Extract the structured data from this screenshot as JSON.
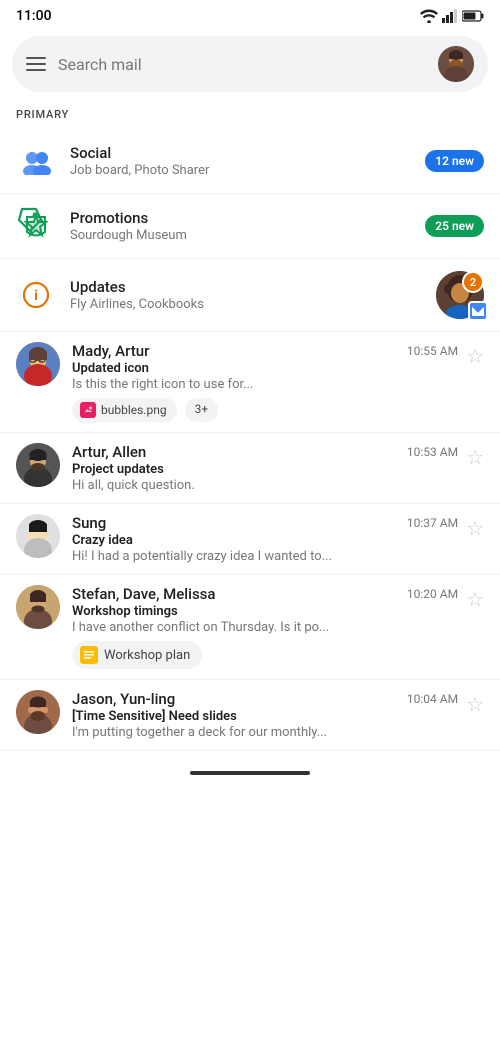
{
  "statusBar": {
    "time": "11:00"
  },
  "searchBar": {
    "placeholder": "Search mail",
    "menuIcon": "☰"
  },
  "sectionLabel": "PRIMARY",
  "categories": [
    {
      "id": "social",
      "name": "Social",
      "subtitle": "Job board, Photo Sharer",
      "badge": "12 new",
      "badgeColor": "blue",
      "iconType": "social"
    },
    {
      "id": "promotions",
      "name": "Promotions",
      "subtitle": "Sourdough Museum",
      "badge": "25 new",
      "badgeColor": "green",
      "iconType": "promotions"
    },
    {
      "id": "updates",
      "name": "Updates",
      "subtitle": "Fly Airlines, Cookbooks",
      "badge": "2",
      "badgeColor": "orange",
      "iconType": "updates"
    }
  ],
  "emails": [
    {
      "id": "mady",
      "sender": "Mady, Artur",
      "time": "10:55 AM",
      "subject": "Updated icon",
      "preview": "Is this the right icon to use for...",
      "avatarType": "image",
      "avatarColor": "#5c8dd5",
      "chips": [
        {
          "label": "bubbles.png",
          "type": "image"
        },
        {
          "label": "3+",
          "type": "more"
        }
      ],
      "starred": false
    },
    {
      "id": "artur",
      "sender": "Artur, Allen",
      "time": "10:53 AM",
      "subject": "Project updates",
      "preview": "Hi all, quick question.",
      "avatarType": "image",
      "avatarColor": "#444",
      "chips": [],
      "starred": false
    },
    {
      "id": "sung",
      "sender": "Sung",
      "time": "10:37 AM",
      "subject": "Crazy idea",
      "preview": "Hi! I had a potentially crazy idea I wanted to...",
      "avatarType": "image",
      "avatarColor": "#ccc",
      "chips": [],
      "starred": false
    },
    {
      "id": "stefan",
      "sender": "Stefan, Dave, Melissa",
      "time": "10:20 AM",
      "subject": "Workshop timings",
      "preview": "I have another conflict on Thursday. Is it po...",
      "avatarType": "image",
      "avatarColor": "#c8a46e",
      "chips": [
        {
          "label": "Workshop plan",
          "type": "doc"
        }
      ],
      "starred": false
    },
    {
      "id": "jason",
      "sender": "Jason, Yun-ling",
      "time": "10:04 AM",
      "subject": "[Time Sensitive] Need slides",
      "preview": "I'm putting together a deck for our monthly...",
      "avatarType": "image",
      "avatarColor": "#b07850",
      "chips": [],
      "starred": false
    }
  ]
}
